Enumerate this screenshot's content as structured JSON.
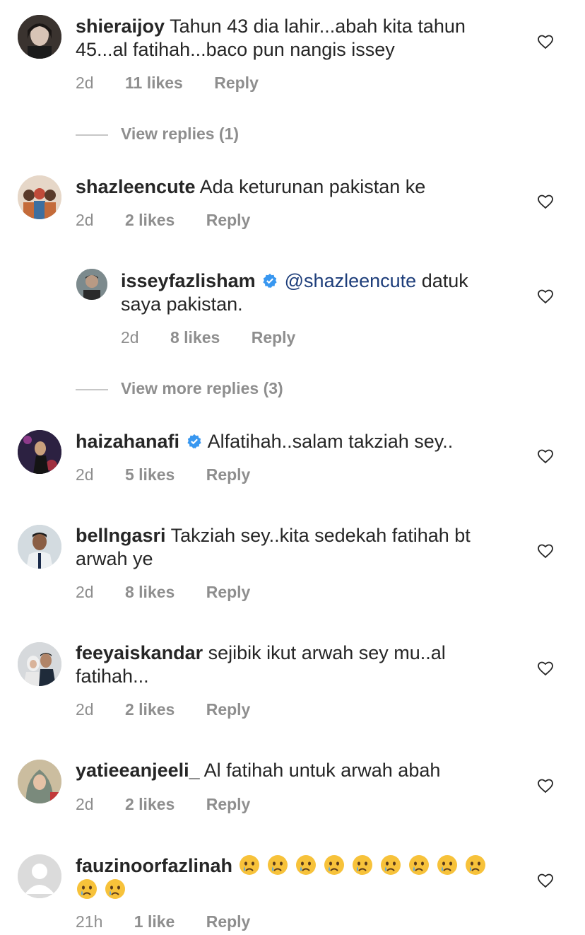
{
  "comments": [
    {
      "user": "shieraijoy",
      "text": "Tahun 43 dia lahir...abah kita tahun 45...al fatihah...baco pun nangis issey",
      "time": "2d",
      "likes": "11 likes",
      "reply": "Reply"
    },
    {
      "user": "shazleencute",
      "text": "Ada keturunan pakistan ke",
      "time": "2d",
      "likes": "2 likes",
      "reply": "Reply"
    },
    {
      "user": "isseyfazlisham",
      "mention": "@shazleencute",
      "text": "datuk saya pakistan.",
      "time": "2d",
      "likes": "8 likes",
      "reply": "Reply"
    },
    {
      "user": "haizahanafi",
      "text": "Alfatihah..salam takziah sey..",
      "time": "2d",
      "likes": "5 likes",
      "reply": "Reply"
    },
    {
      "user": "bellngasri",
      "text": "Takziah sey..kita sedekah fatihah bt arwah ye",
      "time": "2d",
      "likes": "8 likes",
      "reply": "Reply"
    },
    {
      "user": "feeyaiskandar",
      "text": "sejibik ikut arwah sey mu..al fatihah...",
      "time": "2d",
      "likes": "2 likes",
      "reply": "Reply"
    },
    {
      "user": "yatieeanjeeli_",
      "text": "Al fatihah untuk arwah abah",
      "time": "2d",
      "likes": "2 likes",
      "reply": "Reply"
    },
    {
      "user": "fauzinoorfazlinah",
      "text": "",
      "time": "21h",
      "likes": "1 like",
      "reply": "Reply"
    }
  ],
  "view_replies_1": "View replies (1)",
  "view_replies_2": "View more replies (3)",
  "icons": {
    "like": "heart-outline-icon",
    "verified": "verified-badge-icon",
    "emoji": "crying-face-emoji"
  },
  "colors": {
    "text": "#262626",
    "meta": "#8e8e8e",
    "mention": "#1d3d7a",
    "verified": "#3897f0"
  }
}
